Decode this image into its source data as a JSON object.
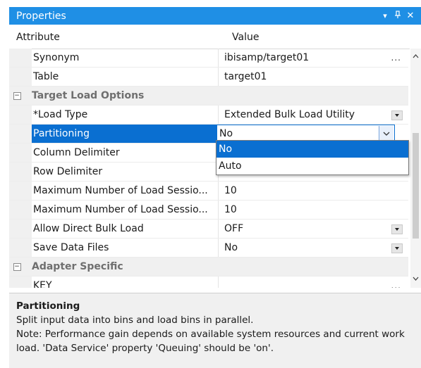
{
  "window": {
    "title": "Properties",
    "dropdown_glyph": "▾",
    "pin_glyph": "📌",
    "close_glyph": "✕"
  },
  "header": {
    "attribute": "Attribute",
    "value": "Value"
  },
  "rows": [
    {
      "attr": "Synonym",
      "value": "ibisamp/target01",
      "control": "ellipsis",
      "control_label": "..."
    },
    {
      "attr": "Table",
      "value": "target01"
    },
    {
      "category": "Target Load Options",
      "expander": "⊟"
    },
    {
      "attr": "*Load Type",
      "value": "Extended Bulk Load Utility",
      "control": "dropdown"
    },
    {
      "attr": "Partitioning",
      "value": "No",
      "control": "edit-dropdown",
      "selected": true
    },
    {
      "attr": "Column Delimiter",
      "value": ""
    },
    {
      "attr": "Row Delimiter",
      "value": ""
    },
    {
      "attr": "Maximum Number of Load Sessio...",
      "value": "10"
    },
    {
      "attr": "Maximum Number of Load Sessio...",
      "value": "10"
    },
    {
      "attr": "Allow Direct Bulk Load",
      "value": "OFF",
      "control": "dropdown"
    },
    {
      "attr": "Save Data Files",
      "value": "No",
      "control": "dropdown"
    },
    {
      "category": "Adapter Specific",
      "expander": "⊟"
    },
    {
      "attr": "KEY",
      "value": "",
      "control": "ellipsis",
      "control_label": "..."
    }
  ],
  "dropdown_options": [
    "No",
    "Auto"
  ],
  "dropdown_highlighted": "No",
  "description": {
    "title": "Partitioning",
    "line1": "Split input data into bins and load bins in parallel.",
    "line2": "Note: Performance gain depends on available system resources and current work load. 'Data Service' property 'Queuing' should be 'on'."
  },
  "colors": {
    "title_bar": "#1f8fe5",
    "selection": "#0a6fd1",
    "category_bg": "#f0f0f0",
    "description_bg": "#f0f0f0"
  },
  "icons": {
    "scroll_up": "chevron-up-icon",
    "scroll_down": "chevron-down-icon",
    "edit_dropdown": "chevron-down-icon"
  }
}
